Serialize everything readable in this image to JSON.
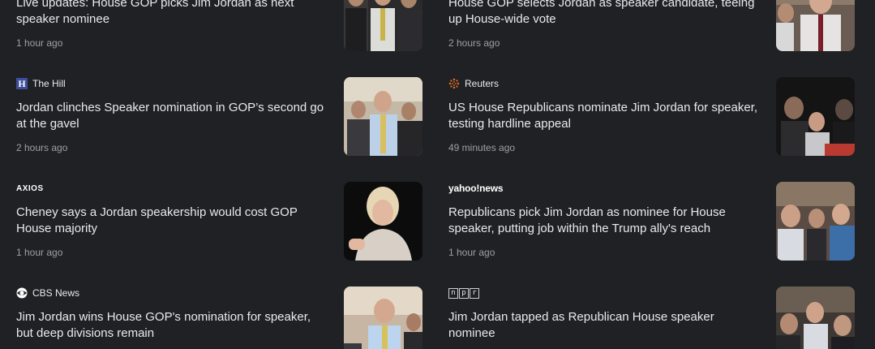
{
  "cards": [
    {
      "source": "",
      "headline": "Live updates: House GOP picks Jim Jordan as next speaker nominee",
      "time": "1 hour ago",
      "logo": "none-icon"
    },
    {
      "source": "",
      "headline": "House GOP selects Jordan as speaker candidate, teeing up House-wide vote",
      "time": "2 hours ago",
      "logo": "none-icon"
    },
    {
      "source": "The Hill",
      "headline": "Jordan clinches Speaker nomination in GOP’s second go at the gavel",
      "time": "2 hours ago",
      "logo": "the-hill-logo-icon"
    },
    {
      "source": "Reuters",
      "headline": "US House Republicans nominate Jim Jordan for speaker, testing hardline appeal",
      "time": "49 minutes ago",
      "logo": "reuters-logo-icon"
    },
    {
      "source": "AXIOS",
      "headline": "Cheney says a Jordan speakership would cost GOP House majority",
      "time": "1 hour ago",
      "logo": "axios-logo-icon"
    },
    {
      "source": "yahoo!news",
      "headline": "Republicans pick Jim Jordan as nominee for House speaker, putting job within the Trump ally's reach",
      "time": "1 hour ago",
      "logo": "yahoo-news-logo-icon"
    },
    {
      "source": "CBS News",
      "headline": "Jim Jordan wins House GOP's nomination for speaker, but deep divisions remain",
      "time": "",
      "logo": "cbs-eye-logo-icon"
    },
    {
      "source": "npr",
      "headline": "Jim Jordan tapped as Republican House speaker nominee",
      "time": "",
      "logo": "npr-logo-icon"
    }
  ],
  "colors": {
    "background": "#202124",
    "headline": "#e8eaed",
    "meta": "#9aa0a6",
    "the_hill_blue": "#3e4d9b",
    "reuters_orange": "#f26f21"
  }
}
